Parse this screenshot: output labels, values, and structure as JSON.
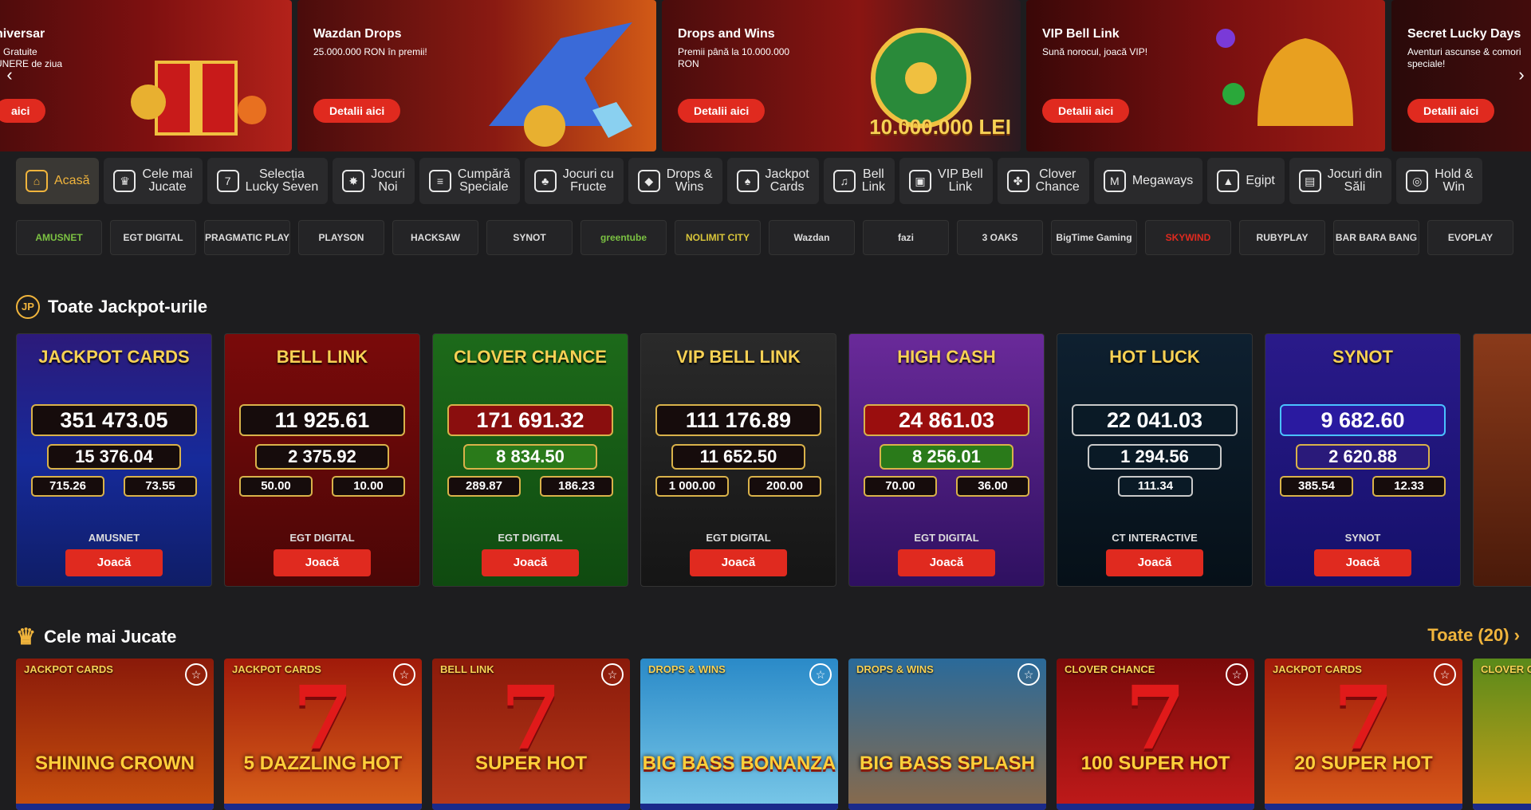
{
  "banners": [
    {
      "title": "niversar",
      "subtitle": "ri Gratuite\nUNERE de ziua",
      "button": "aici"
    },
    {
      "title": "Wazdan Drops",
      "subtitle": "25.000.000 RON în premii!",
      "button": "Detalii aici"
    },
    {
      "title": "Drops and Wins",
      "subtitle": "Premii până la 10.000.000 RON",
      "button": "Detalii aici",
      "art_text": "10.000.000 LEI"
    },
    {
      "title": "VIP Bell Link",
      "subtitle": "Sună norocul, joacă VIP!",
      "button": "Detalii aici"
    },
    {
      "title": "Secret Lucky Days",
      "subtitle": "Aventuri ascunse & comori speciale!",
      "button": "Detalii aici"
    }
  ],
  "nav_arrows": {
    "prev": "‹",
    "next": "›"
  },
  "categories": [
    {
      "label": "Acasă",
      "icon": "home-icon",
      "glyph": "⌂"
    },
    {
      "label": "Cele mai\nJucate",
      "icon": "crown-icon",
      "glyph": "♛"
    },
    {
      "label": "Selecția\nLucky Seven",
      "icon": "seven-icon",
      "glyph": "7"
    },
    {
      "label": "Jocuri\nNoi",
      "icon": "new-badge-icon",
      "glyph": "✸"
    },
    {
      "label": "Cumpără\nSpeciale",
      "icon": "coin-stack-icon",
      "glyph": "≡"
    },
    {
      "label": "Jocuri cu\nFructe",
      "icon": "cherry-icon",
      "glyph": "♣"
    },
    {
      "label": "Drops &\nWins",
      "icon": "drop-icon",
      "glyph": "◆"
    },
    {
      "label": "Jackpot\nCards",
      "icon": "cards-icon",
      "glyph": "♠"
    },
    {
      "label": "Bell\nLink",
      "icon": "bell-icon",
      "glyph": "♫"
    },
    {
      "label": "VIP Bell\nLink",
      "icon": "vip-slot-icon",
      "glyph": "▣"
    },
    {
      "label": "Clover\nChance",
      "icon": "clover-icon",
      "glyph": "✤"
    },
    {
      "label": "Megaways",
      "icon": "megaways-icon",
      "glyph": "M"
    },
    {
      "label": "Egipt",
      "icon": "pharaoh-icon",
      "glyph": "▲"
    },
    {
      "label": "Jocuri din\nSăli",
      "icon": "slot-machine-icon",
      "glyph": "▤"
    },
    {
      "label": "Hold &\nWin",
      "icon": "coins-icon",
      "glyph": "◎"
    }
  ],
  "providers": [
    "AMUSNET",
    "EGT DIGITAL",
    "PRAGMATIC PLAY",
    "PLAYSON",
    "HACKSAW",
    "SYNOT",
    "greentube",
    "NOLIMIT CITY",
    "Wazdan",
    "fazi",
    "3 OAKS",
    "BigTime Gaming",
    "SKYWIND",
    "RUBYPLAY",
    "BAR BARA BANG",
    "EVOPLAY"
  ],
  "jackpots_section": {
    "title": "Toate Jackpot-urile",
    "icon": "jackpot-icon",
    "icon_text": "JP"
  },
  "jackpots": [
    {
      "logo": "JACKPOT CARDS",
      "v1": "351 473.05",
      "v2": "15 376.04",
      "v3": "715.26",
      "v4": "73.55",
      "provider": "AMUSNET",
      "play": "Joacă"
    },
    {
      "logo": "BELL LINK",
      "v1": "11 925.61",
      "v2": "2 375.92",
      "v3": "50.00",
      "v4": "10.00",
      "provider": "EGT DIGITAL",
      "play": "Joacă"
    },
    {
      "logo": "CLOVER CHANCE",
      "v1": "171 691.32",
      "v2": "8 834.50",
      "v3": "289.87",
      "v4": "186.23",
      "provider": "EGT DIGITAL",
      "play": "Joacă"
    },
    {
      "logo": "VIP BELL LINK",
      "v1": "111 176.89",
      "v2": "11 652.50",
      "v3": "1 000.00",
      "v4": "200.00",
      "provider": "EGT DIGITAL",
      "play": "Joacă"
    },
    {
      "logo": "HIGH CASH",
      "v1": "24 861.03",
      "v2": "8 256.01",
      "v3": "70.00",
      "v4": "36.00",
      "provider": "EGT DIGITAL",
      "play": "Joacă"
    },
    {
      "logo": "HOT LUCK",
      "v1": "22 041.03",
      "v2": "1 294.56",
      "v3": "111.34",
      "v4": "",
      "provider": "CT INTERACTIVE",
      "play": "Joacă"
    },
    {
      "logo": "SYNOT",
      "v1": "9 682.60",
      "v2": "2 620.88",
      "v3": "385.54",
      "v4": "12.33",
      "provider": "SYNOT",
      "play": "Joacă"
    },
    {
      "logo": "",
      "v1": "",
      "v2": "",
      "v3": "",
      "v4": "",
      "provider": "",
      "play": ""
    }
  ],
  "popular_section": {
    "title": "Cele mai Jucate",
    "icon": "crown-icon",
    "see_all": "Toate (20) ›"
  },
  "games": [
    {
      "badge": "JACKPOT CARDS",
      "name": "SHINING CROWN",
      "art": ""
    },
    {
      "badge": "JACKPOT CARDS",
      "name": "5 DAZZLING HOT",
      "art": "7"
    },
    {
      "badge": "BELL LINK",
      "name": "SUPER HOT",
      "art": "7"
    },
    {
      "badge": "DROPS & WINS",
      "name": "BIG BASS BONANZA",
      "art": ""
    },
    {
      "badge": "DROPS & WINS",
      "name": "BIG BASS SPLASH",
      "art": ""
    },
    {
      "badge": "CLOVER CHANCE",
      "name": "100 SUPER HOT",
      "art": "7"
    },
    {
      "badge": "JACKPOT CARDS",
      "name": "20 SUPER HOT",
      "art": "7"
    },
    {
      "badge": "CLOVER CHANCE",
      "name": "",
      "art": ""
    }
  ],
  "star_glyph": "☆"
}
